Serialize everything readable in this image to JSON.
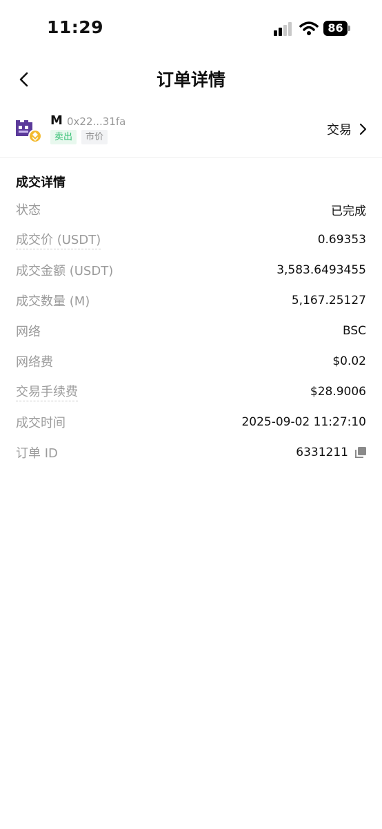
{
  "status_bar": {
    "time": "11:29",
    "battery": "86"
  },
  "nav": {
    "title": "订单详情"
  },
  "token": {
    "symbol": "M",
    "address": "0x22...31fa",
    "tags": {
      "side": "卖出",
      "type": "市价"
    },
    "trade_label": "交易"
  },
  "details": {
    "section_title": "成交详情",
    "rows": [
      {
        "label": "状态",
        "value": "已完成"
      },
      {
        "label": "成交价 (USDT)",
        "value": "0.69353"
      },
      {
        "label": "成交金额 (USDT)",
        "value": "3,583.6493455"
      },
      {
        "label": "成交数量 (M)",
        "value": "5,167.25127"
      },
      {
        "label": "网络",
        "value": "BSC"
      },
      {
        "label": "网络费",
        "value": "$0.02"
      },
      {
        "label": "交易手续费",
        "value": "$28.9006"
      },
      {
        "label": "成交时间",
        "value": "2025-09-02 11:27:10"
      },
      {
        "label": "订单 ID",
        "value": "6331211"
      }
    ]
  },
  "colors": {
    "sell_green": "#2dbd6e",
    "label_gray": "#9b9b9b"
  },
  "icons": [
    "signal-icon",
    "wifi-icon",
    "battery-icon",
    "back-icon",
    "token-logo-icon",
    "chevron-right-icon",
    "copy-icon"
  ]
}
